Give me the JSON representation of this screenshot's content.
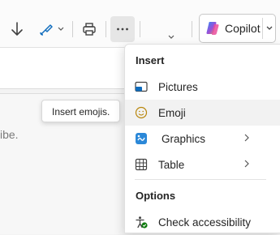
{
  "toolbar": {
    "copilot_label": "Copilot"
  },
  "tooltip": {
    "text": "Insert emojis."
  },
  "background_text": {
    "snippet": "ibe."
  },
  "menu": {
    "insert_header": "Insert",
    "items": [
      {
        "label": "Pictures"
      },
      {
        "label": "Emoji"
      },
      {
        "label": "Graphics"
      },
      {
        "label": "Table"
      }
    ],
    "options_header": "Options",
    "options_items": [
      {
        "label": "Check accessibility"
      }
    ]
  },
  "colors": {
    "accent_blue": "#0f6cbd",
    "copilot_gradient": [
      "#2f8cf5",
      "#9c4fd8",
      "#f0a04b"
    ],
    "accessibility_green": "#107c10"
  }
}
